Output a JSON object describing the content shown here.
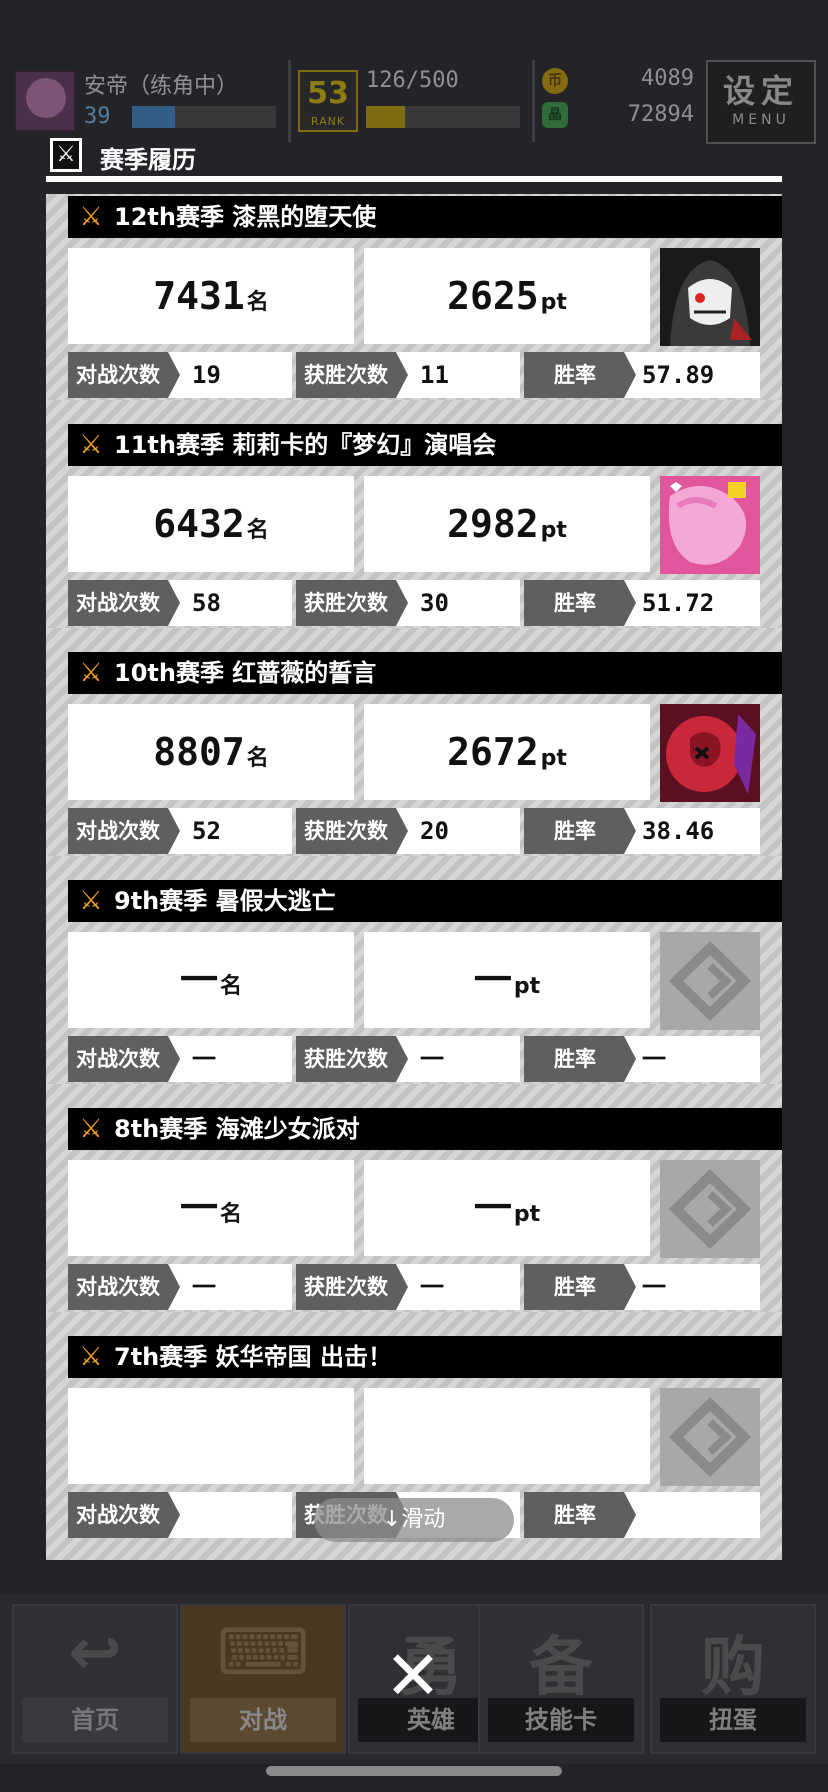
{
  "status_bar": {
    "player_name": "安帝（练角中）",
    "player_level": "39",
    "player_level_progress": 0.3,
    "rank_number": "53",
    "rank_text": "RANK",
    "rank_progress_text": "126/500",
    "rank_progress": 0.252,
    "coin_symbol": "币",
    "coins": "4089",
    "gem_symbol": "晶",
    "gems": "72894",
    "settings_label": "设定",
    "settings_sub": "MENU"
  },
  "modal": {
    "title": "赛季履历",
    "close_glyph": "✕"
  },
  "stat_labels": {
    "battles": "对战次数",
    "wins": "获胜次数",
    "win_rate": "胜率"
  },
  "seasons": [
    {
      "title": "12th赛季  漆黑的堕天使",
      "rank": "7431",
      "rank_unit": "名",
      "pt": "2625",
      "pt_unit": "pt",
      "battles": "19",
      "wins": "11",
      "win_rate": "57.89",
      "portrait": "dark-hooded-angel"
    },
    {
      "title": "11th赛季  莉莉卡的『梦幻』演唱会",
      "rank": "6432",
      "rank_unit": "名",
      "pt": "2982",
      "pt_unit": "pt",
      "battles": "58",
      "wins": "30",
      "win_rate": "51.72",
      "portrait": "pink-idol"
    },
    {
      "title": "10th赛季  红蔷薇的誓言",
      "rank": "8807",
      "rank_unit": "名",
      "pt": "2672",
      "pt_unit": "pt",
      "battles": "52",
      "wins": "20",
      "win_rate": "38.46",
      "portrait": "red-rose"
    },
    {
      "title": "9th赛季  暑假大逃亡",
      "rank": "一",
      "rank_unit": "名",
      "pt": "一",
      "pt_unit": "pt",
      "battles": "一",
      "wins": "一",
      "win_rate": "一",
      "portrait": "placeholder"
    },
    {
      "title": "8th赛季  海滩少女派对",
      "rank": "一",
      "rank_unit": "名",
      "pt": "一",
      "pt_unit": "pt",
      "battles": "一",
      "wins": "一",
      "win_rate": "一",
      "portrait": "placeholder"
    },
    {
      "title": "7th赛季  妖华帝国  出击！",
      "rank": "",
      "rank_unit": "",
      "pt": "",
      "pt_unit": "",
      "battles": "",
      "wins": "",
      "win_rate": "",
      "portrait": "placeholder"
    }
  ],
  "scroll_hint": "↓滑动",
  "bottom_nav": [
    {
      "label": "首页",
      "glyph": "↩"
    },
    {
      "label": "对战",
      "glyph": "⌨"
    },
    {
      "label": "英雄",
      "glyph": "勇"
    },
    {
      "label": "技能卡",
      "glyph": "备"
    },
    {
      "label": "扭蛋",
      "glyph": "购"
    }
  ],
  "colors": {
    "accent_orange": "#f0a020",
    "level_bar": "#3c8fd6",
    "rank_gold": "#c8a800"
  }
}
